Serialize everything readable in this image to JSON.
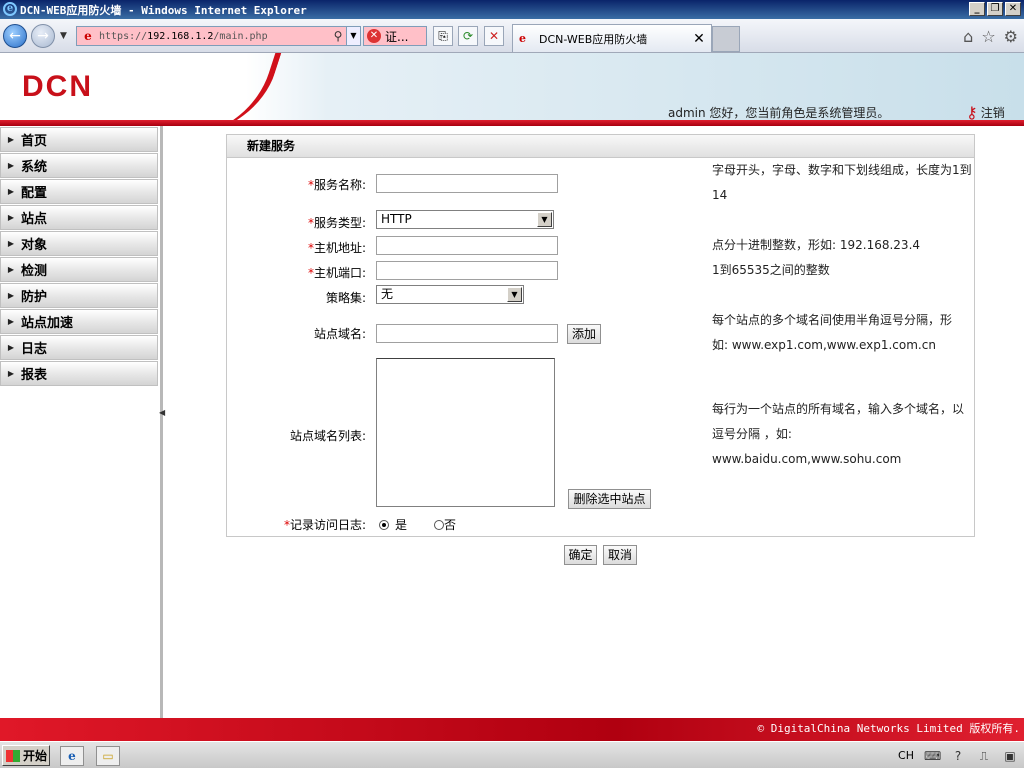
{
  "window": {
    "title": "DCN-WEB应用防火墙 - Windows Internet Explorer"
  },
  "browser": {
    "url_prefix": "https://",
    "url_host": "192.168.1.2",
    "url_path": "/main.php",
    "cert_error": "证...",
    "tab_title": "DCN-WEB应用防火墙"
  },
  "header": {
    "logo": "DCN",
    "welcome": "admin 您好，您当前角色是系统管理员。",
    "logout": "注销"
  },
  "sidebar": {
    "items": [
      {
        "label": "首页"
      },
      {
        "label": "系统"
      },
      {
        "label": "配置"
      },
      {
        "label": "站点"
      },
      {
        "label": "对象"
      },
      {
        "label": "检测"
      },
      {
        "label": "防护"
      },
      {
        "label": "站点加速"
      },
      {
        "label": "日志"
      },
      {
        "label": "报表"
      }
    ]
  },
  "form": {
    "title": "新建服务",
    "service_name": {
      "label": "服务名称:",
      "value": "",
      "hint_line1": "字母开头，字母、数字和下划线组成，长度为1到",
      "hint_line2": "14"
    },
    "service_type": {
      "label": "服务类型:",
      "value": "HTTP"
    },
    "host_address": {
      "label": "主机地址:",
      "value": "",
      "hint": "点分十进制整数，形如: 192.168.23.4"
    },
    "host_port": {
      "label": "主机端口:",
      "value": "",
      "hint": "1到65535之间的整数"
    },
    "policy_set": {
      "label": "策略集:",
      "value": "无"
    },
    "site_domain": {
      "label": "站点域名:",
      "value": "",
      "add_button": "添加",
      "hint_line1": "每个站点的多个域名间使用半角逗号分隔，形",
      "hint_line2": "如: www.exp1.com,www.exp1.com.cn"
    },
    "domain_list": {
      "label": "站点域名列表:",
      "delete_button": "删除选中站点",
      "hint_line1": "每行为一个站点的所有域名，输入多个域名，以",
      "hint_line2": "逗号分隔 ，如:",
      "hint_line3": "www.baidu.com,www.sohu.com"
    },
    "access_log": {
      "label": "记录访问日志:",
      "yes": "是",
      "no": "否",
      "selected": "是"
    },
    "ok_button": "确定",
    "cancel_button": "取消",
    "required_mark": "*"
  },
  "footer": {
    "copyright": "© DigitalChina Networks Limited 版权所有."
  },
  "taskbar": {
    "start": "开始",
    "lang": "CH"
  }
}
